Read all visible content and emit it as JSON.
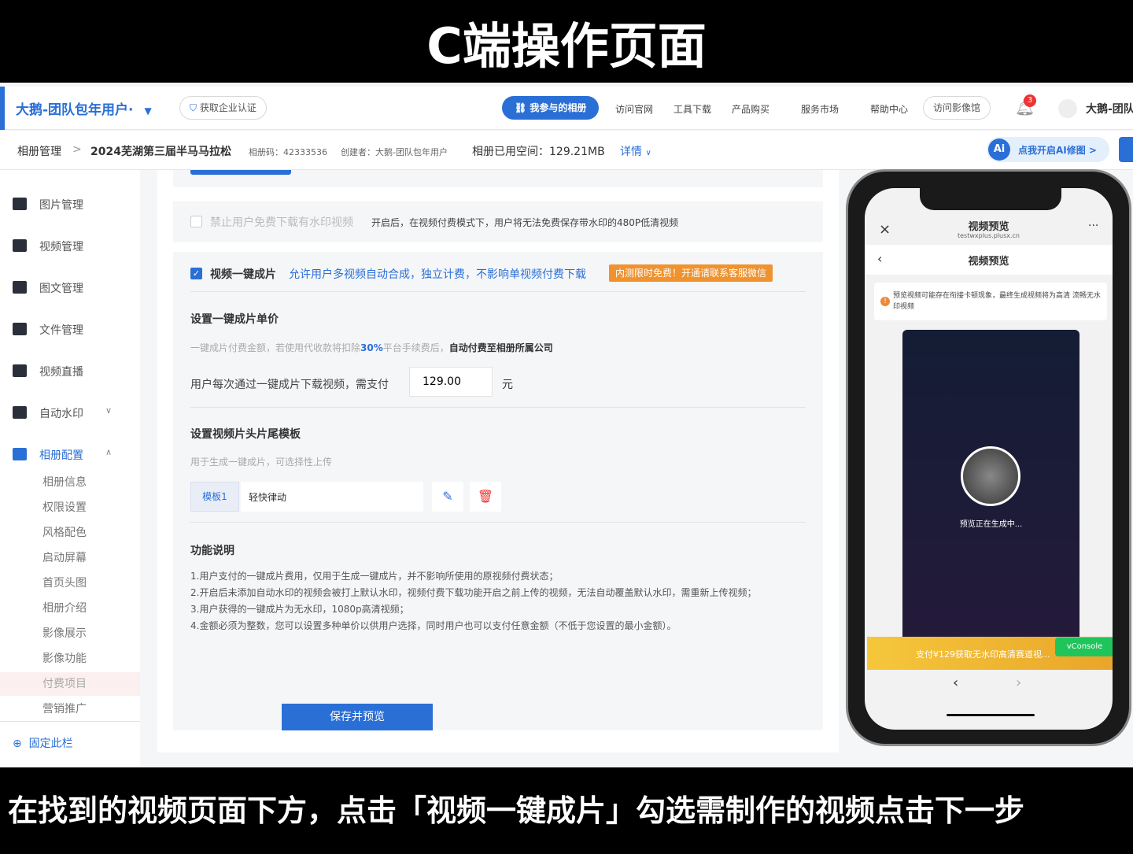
{
  "captions": {
    "top": "C端操作页面",
    "bottom": "在找到的视频页面下方，点击「视频一键成片」勾选需制作的视频点击下一步"
  },
  "header": {
    "brand": "大鹅-团队包年用户·",
    "cert": "获取企业认证",
    "my_albums": "我参与的相册",
    "nav": [
      "访问官网",
      "工具下载",
      "产品购买",
      "服务市场",
      "帮助中心"
    ],
    "gallery": "访问影像馆",
    "notif_count": "3",
    "user": "大鹅-团队"
  },
  "breadcrumb": {
    "root": "相册管理",
    "sep": ">",
    "album": "2024芜湖第三届半马马拉松",
    "code": "相册码：42333536",
    "creator": "创建者：大鹅-团队包年用户",
    "space": "相册已用空间：129.21MB",
    "details": "详情",
    "ai": "点我开启AI修图 >"
  },
  "sidebar": {
    "items": [
      "图片管理",
      "视频管理",
      "图文管理",
      "文件管理",
      "视频直播",
      "自动水印",
      "相册配置"
    ],
    "subitems": [
      "相册信息",
      "权限设置",
      "风格配色",
      "启动屏幕",
      "首页头图",
      "相册介绍",
      "影像展示",
      "影像功能",
      "付费项目",
      "营销推广"
    ],
    "active_sub": "付费项目",
    "pin": "固定此栏"
  },
  "main": {
    "forbid_label": "禁止用户免费下载有水印视频",
    "forbid_desc": "开启后，在视频付费模式下，用户将无法免费保存带水印的480P低清视频",
    "forbid_checked": false,
    "oneclick_label": "视频一键成片",
    "oneclick_checked": true,
    "oneclick_desc": "允许用户多视频自动合成，独立计费，不影响单视频付费下载",
    "oneclick_badge": "内测限时免费！开通请联系客服微信",
    "price_title": "设置一键成片单价",
    "price_hint_a": "一键成片付费金额，若使用代收款将扣除",
    "price_hint_pct": "30%",
    "price_hint_b": "平台手续费后，",
    "price_hint_c": "自动付费至相册所属公司",
    "price_label": "用户每次通过一键成片下载视频，需支付",
    "price_value": "129.00",
    "price_unit": "元",
    "template_title": "设置视频片头片尾模板",
    "template_hint": "用于生成一键成片，可选择性上传",
    "template_tag": "模板1",
    "template_name": "轻快律动",
    "desc_title": "功能说明",
    "desc": [
      "1.用户支付的一键成片费用，仅用于生成一键成片，并不影响所使用的原视频付费状态；",
      "2.开启后未添加自动水印的视频会被打上默认水印，视频付费下载功能开启之前上传的视频，无法自动覆盖默认水印，需重新上传视频；",
      "3.用户获得的一键成片为无水印，1080p高清视频；",
      "4.金额必须为整数，您可以设置多种单价以供用户选择，同时用户也可以支付任意金额（不低于您设置的最小金额）。"
    ],
    "save": "保存并预览"
  },
  "phone": {
    "title": "视频预览",
    "domain": "testwxplus.plusx.cn",
    "page_title": "视频预览",
    "notice": "预览视频可能存在衔接卡顿现象，最终生成视频将为高清 流畅无水印视频",
    "loading": "预览正在生成中...",
    "pay": "支付¥129获取无水印高清赛道视...",
    "vconsole": "vConsole"
  },
  "colors": {
    "accent": "#2a6fd6",
    "badge": "#f0922e",
    "pay_bar": "#f2b731",
    "vconsole": "#1fc55b"
  }
}
